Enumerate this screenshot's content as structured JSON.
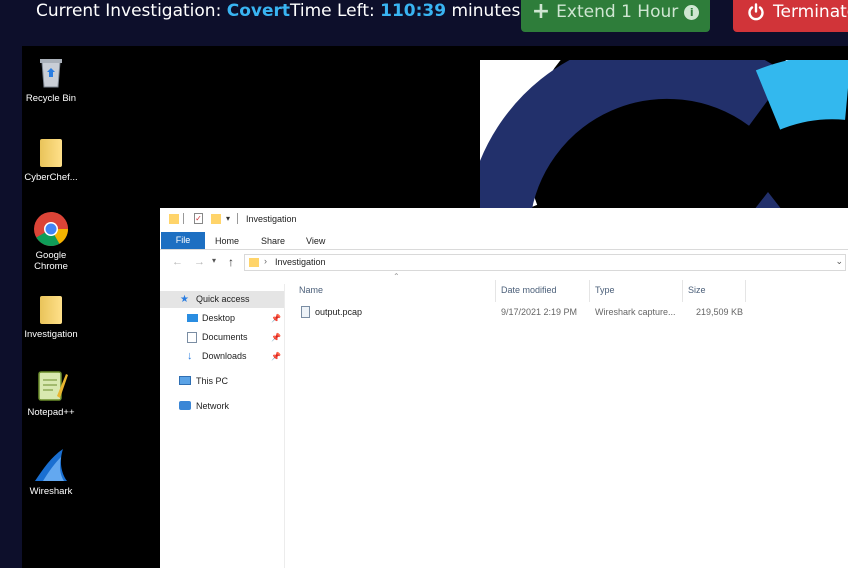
{
  "topbar": {
    "investigation_label": "Current Investigation:",
    "investigation_name": "Covert",
    "time_label": "Time Left:",
    "time_value": "110:39",
    "time_unit": "minutes",
    "extend_label": "Extend 1 Hour",
    "terminate_label": "Terminate"
  },
  "desktop": {
    "icons": [
      {
        "label": "Recycle Bin"
      },
      {
        "label": "CyberChef..."
      },
      {
        "label": "Google Chrome"
      },
      {
        "label": "Investigation"
      },
      {
        "label": "Notepad++"
      },
      {
        "label": "Wireshark"
      }
    ]
  },
  "explorer": {
    "title": "Investigation",
    "ribbon_tabs": [
      "File",
      "Home",
      "Share",
      "View"
    ],
    "address_path": "Investigation",
    "nav": {
      "quick_access": "Quick access",
      "desktop": "Desktop",
      "documents": "Documents",
      "downloads": "Downloads",
      "this_pc": "This PC",
      "network": "Network"
    },
    "columns": [
      "Name",
      "Date modified",
      "Type",
      "Size"
    ],
    "files": [
      {
        "name": "output.pcap",
        "date": "9/17/2021 2:19 PM",
        "type": "Wireshark capture...",
        "size": "219,509 KB"
      }
    ]
  },
  "colors": {
    "topbar_bg": "#0d0f2b",
    "accent_blue": "#39b4f2",
    "extend_green": "#2e7d3a",
    "terminate_red": "#d13439",
    "logo_navy": "#22306b",
    "logo_cyan": "#33b8ee"
  }
}
